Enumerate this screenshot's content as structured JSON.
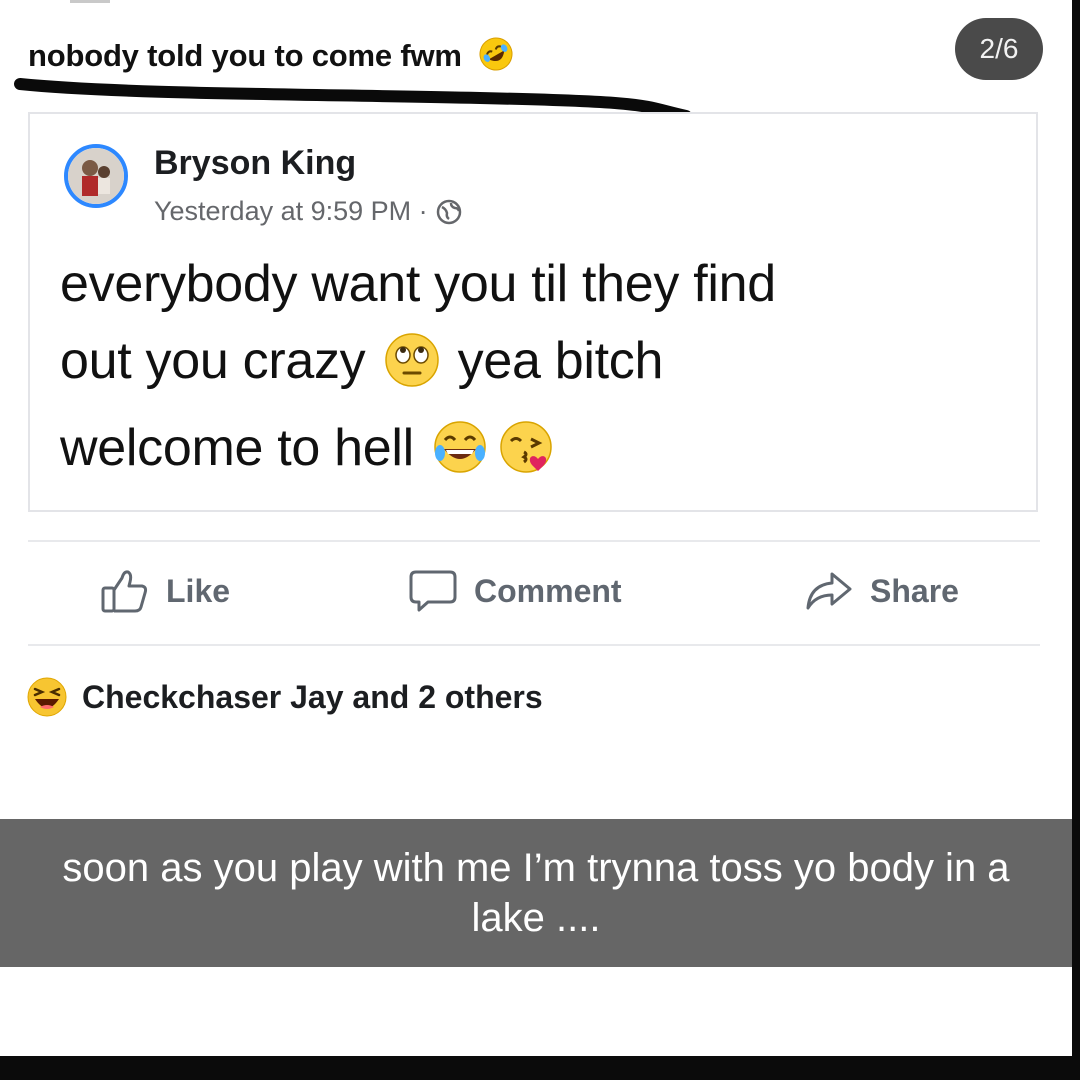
{
  "overlay": {
    "top_caption": "nobody told you to come fwm",
    "page_indicator": "2/6",
    "bottom_caption": "soon as you play with me I’m trynna toss yo body in a lake ...."
  },
  "post": {
    "author": "Bryson King",
    "timestamp": "Yesterday at 9:59 PM · ",
    "text_line1": "everybody want you til they find",
    "text_line2a": "out you crazy",
    "text_line2b": "yea bitch",
    "text_line3": "welcome to hell"
  },
  "actions": {
    "like_label": "Like",
    "comment_label": "Comment",
    "share_label": "Share"
  },
  "reactions": {
    "summary": "Checkchaser Jay and 2 others"
  },
  "icons": [
    "rofl-emoji",
    "globe-icon",
    "eye-roll-emoji",
    "tears-of-joy-emoji",
    "kiss-emoji",
    "like-icon",
    "comment-icon",
    "share-icon",
    "haha-reaction"
  ],
  "colors": {
    "avatar_ring": "#2d88ff",
    "action_text": "#606770",
    "caption_bar": "#666666",
    "page_badge": "#4a4a4a"
  }
}
